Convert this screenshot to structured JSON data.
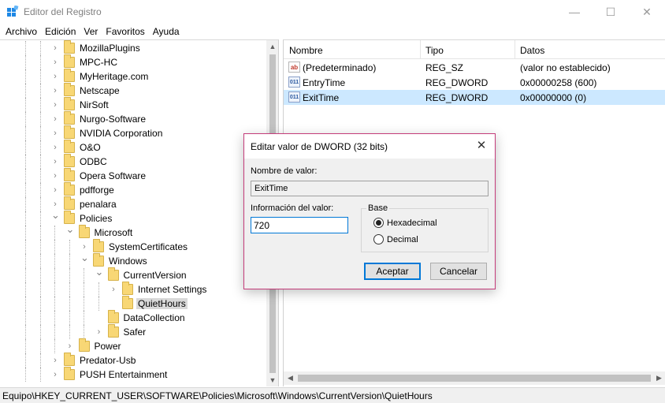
{
  "window": {
    "title": "Editor del Registro"
  },
  "window_controls": {
    "minimize": "—",
    "maximize": "☐",
    "close": "✕"
  },
  "menu": [
    "Archivo",
    "Edición",
    "Ver",
    "Favoritos",
    "Ayuda"
  ],
  "tree": {
    "items": [
      {
        "label": "MozillaPlugins",
        "level": 4,
        "expanded": false
      },
      {
        "label": "MPC-HC",
        "level": 4,
        "expanded": false
      },
      {
        "label": "MyHeritage.com",
        "level": 4,
        "expanded": false
      },
      {
        "label": "Netscape",
        "level": 4,
        "expanded": false
      },
      {
        "label": "NirSoft",
        "level": 4,
        "expanded": false
      },
      {
        "label": "Nurgo-Software",
        "level": 4,
        "expanded": false
      },
      {
        "label": "NVIDIA Corporation",
        "level": 4,
        "expanded": false
      },
      {
        "label": "O&O",
        "level": 4,
        "expanded": false
      },
      {
        "label": "ODBC",
        "level": 4,
        "expanded": false
      },
      {
        "label": "Opera Software",
        "level": 4,
        "expanded": false
      },
      {
        "label": "pdfforge",
        "level": 4,
        "expanded": false
      },
      {
        "label": "penalara",
        "level": 4,
        "expanded": false
      },
      {
        "label": "Policies",
        "level": 4,
        "expanded": true
      },
      {
        "label": "Microsoft",
        "level": 5,
        "expanded": true
      },
      {
        "label": "SystemCertificates",
        "level": 6,
        "expanded": false
      },
      {
        "label": "Windows",
        "level": 6,
        "expanded": true
      },
      {
        "label": "CurrentVersion",
        "level": 7,
        "expanded": true
      },
      {
        "label": "Internet Settings",
        "level": 8,
        "expanded": false
      },
      {
        "label": "QuietHours",
        "level": 8,
        "expanded": null,
        "selected": true
      },
      {
        "label": "DataCollection",
        "level": 7,
        "expanded": null
      },
      {
        "label": "Safer",
        "level": 7,
        "expanded": false
      },
      {
        "label": "Power",
        "level": 5,
        "expanded": false
      },
      {
        "label": "Predator-Usb",
        "level": 4,
        "expanded": false
      },
      {
        "label": "PUSH Entertainment",
        "level": 4,
        "expanded": false
      }
    ]
  },
  "list": {
    "columns": [
      "Nombre",
      "Tipo",
      "Datos"
    ],
    "rows": [
      {
        "icon": "ab",
        "name": "(Predeterminado)",
        "type": "REG_SZ",
        "data": "(valor no establecido)",
        "selected": false
      },
      {
        "icon": "011",
        "name": "EntryTime",
        "type": "REG_DWORD",
        "data": "0x00000258 (600)",
        "selected": false
      },
      {
        "icon": "011",
        "name": "ExitTime",
        "type": "REG_DWORD",
        "data": "0x00000000 (0)",
        "selected": true
      }
    ]
  },
  "dialog": {
    "title": "Editar valor de DWORD (32 bits)",
    "close": "✕",
    "name_label": "Nombre de valor:",
    "name_value": "ExitTime",
    "data_label": "Información del valor:",
    "data_value": "720",
    "base_label": "Base",
    "base_options": [
      "Hexadecimal",
      "Decimal"
    ],
    "base_selected": "Hexadecimal",
    "ok_label": "Aceptar",
    "cancel_label": "Cancelar"
  },
  "statusbar": {
    "path": "Equipo\\HKEY_CURRENT_USER\\SOFTWARE\\Policies\\Microsoft\\Windows\\CurrentVersion\\QuietHours"
  },
  "colors": {
    "selection": "#cce8ff",
    "tree_selection": "#d9d9d9",
    "dialog_border": "#c43c7a",
    "accent": "#0078d7",
    "folder": "#f8d775"
  }
}
